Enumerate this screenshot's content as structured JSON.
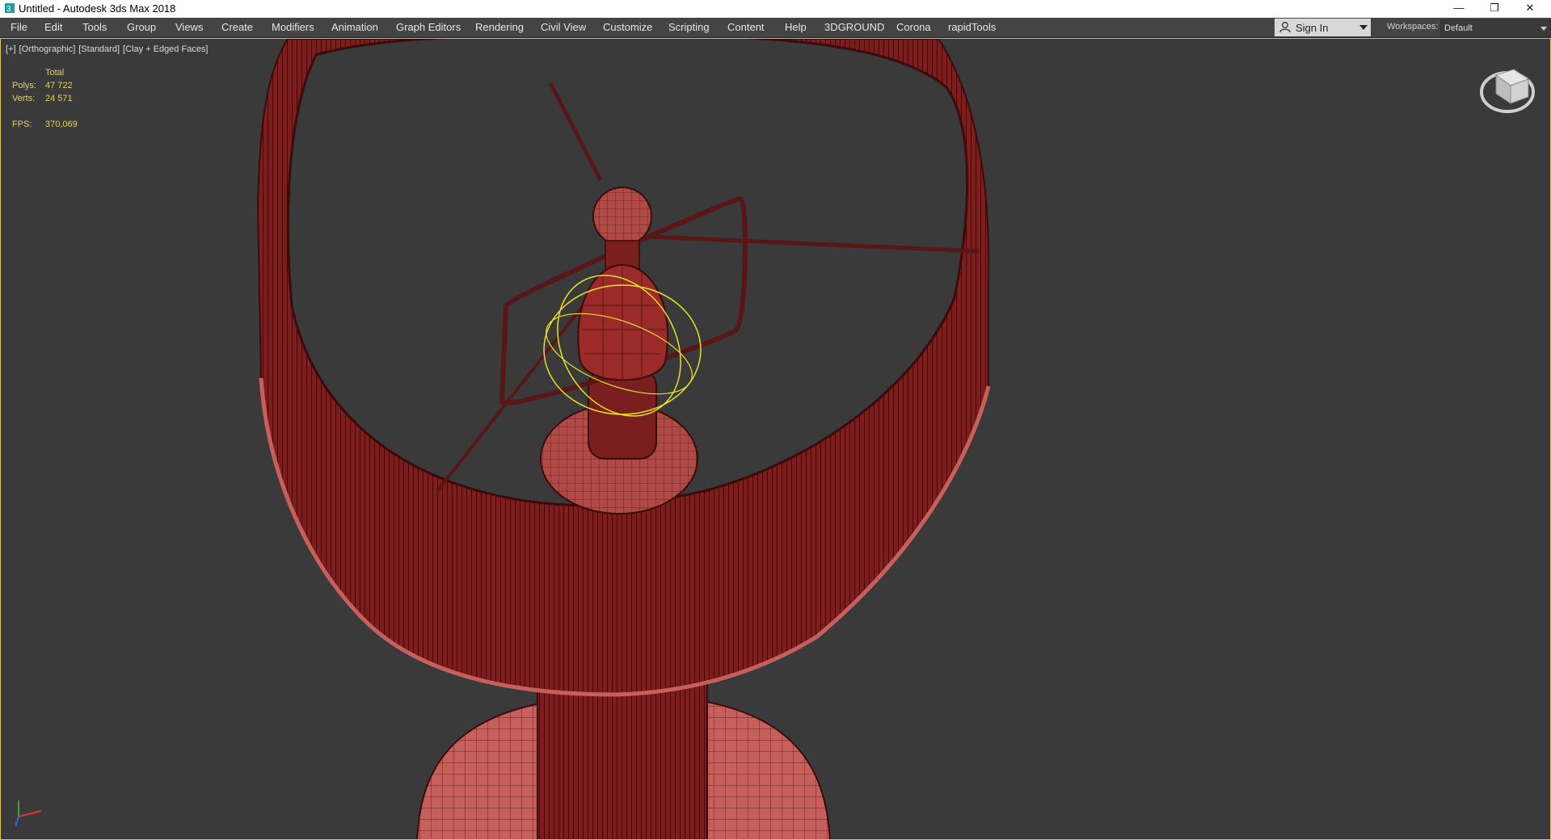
{
  "window": {
    "title": "Untitled - Autodesk 3ds Max 2018",
    "controls": {
      "minimize": "—",
      "restore": "❐",
      "close": "✕"
    }
  },
  "menu": {
    "items": [
      "File",
      "Edit",
      "Tools",
      "Group",
      "Views",
      "Create",
      "Modifiers",
      "Animation",
      "Graph Editors",
      "Rendering",
      "Civil View",
      "Customize",
      "Scripting",
      "Content",
      "Help",
      "3DGROUND",
      "Corona",
      "rapidTools"
    ],
    "sign_in": "Sign In",
    "workspaces_label": "Workspaces:",
    "workspace_value": "Default"
  },
  "viewport": {
    "labels": [
      "[+]",
      "[Orthographic]",
      "[Standard]",
      "[Clay + Edged Faces]"
    ],
    "stats": {
      "total_header": "Total",
      "polys_label": "Polys:",
      "polys_value": "47 722",
      "verts_label": "Verts:",
      "verts_value": "24 571",
      "fps_label": "FPS:",
      "fps_value": "370,069"
    }
  },
  "colors": {
    "mesh_fill": "#7a1f1f",
    "mesh_dark": "#3a0b0b",
    "mesh_light": "#c7605c",
    "selection": "#e8e02a",
    "viewport_bg": "#3a3a3a",
    "menubar_bg": "#444444",
    "stats_text": "#e3d06b"
  },
  "icons": {
    "app": "3ds-max-logo-icon",
    "user": "user-icon",
    "viewcube": "viewcube-icon",
    "axis_tripod": "axis-tripod-icon"
  }
}
